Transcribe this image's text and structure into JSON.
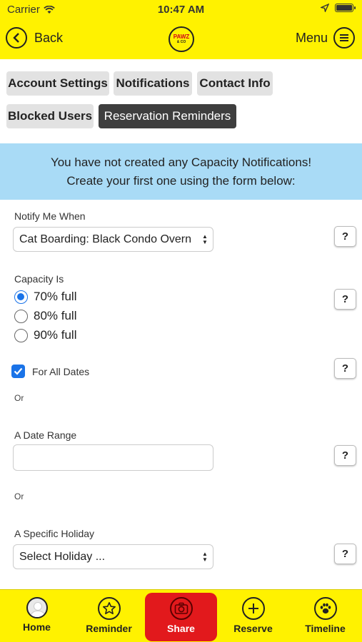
{
  "status_bar": {
    "carrier": "Carrier",
    "time": "10:47 AM"
  },
  "header": {
    "back_label": "Back",
    "menu_label": "Menu",
    "logo_line1": "PAWZ",
    "logo_line2": "& CO"
  },
  "tabs": [
    {
      "label": "Account Settings",
      "active": false
    },
    {
      "label": "Notifications",
      "active": false
    },
    {
      "label": "Contact Info",
      "active": false
    },
    {
      "label": "Blocked Users",
      "active": false
    },
    {
      "label": "Reservation Reminders",
      "active": true
    }
  ],
  "banner": {
    "line1": "You have not created any Capacity Notifications!",
    "line2": "Create your first one using the form below:"
  },
  "form": {
    "notify_label": "Notify Me When",
    "notify_value": "Cat Boarding: Black Condo Overn",
    "capacity_label": "Capacity Is",
    "capacity_options": [
      {
        "label": "70% full",
        "checked": true
      },
      {
        "label": "80% full",
        "checked": false
      },
      {
        "label": "90% full",
        "checked": false
      }
    ],
    "all_dates_label": "For All Dates",
    "all_dates_checked": true,
    "or1": "Or",
    "date_range_label": "A Date Range",
    "date_range_value": "",
    "or2": "Or",
    "holiday_label": "A Specific Holiday",
    "holiday_value": "Select Holiday ...",
    "help_label": "?"
  },
  "tabbar": [
    {
      "label": "Home",
      "icon": "avatar-icon"
    },
    {
      "label": "Reminder",
      "icon": "star-icon"
    },
    {
      "label": "Share",
      "icon": "camera-icon",
      "highlighted": true
    },
    {
      "label": "Reserve",
      "icon": "plus-icon"
    },
    {
      "label": "Timeline",
      "icon": "paw-icon"
    }
  ],
  "colors": {
    "header_bg": "#FFF200",
    "banner_bg": "#A9DBF6",
    "active_tab_bg": "#3E3E3E",
    "share_bg": "#E2191C",
    "accent_blue": "#1a73e8"
  }
}
